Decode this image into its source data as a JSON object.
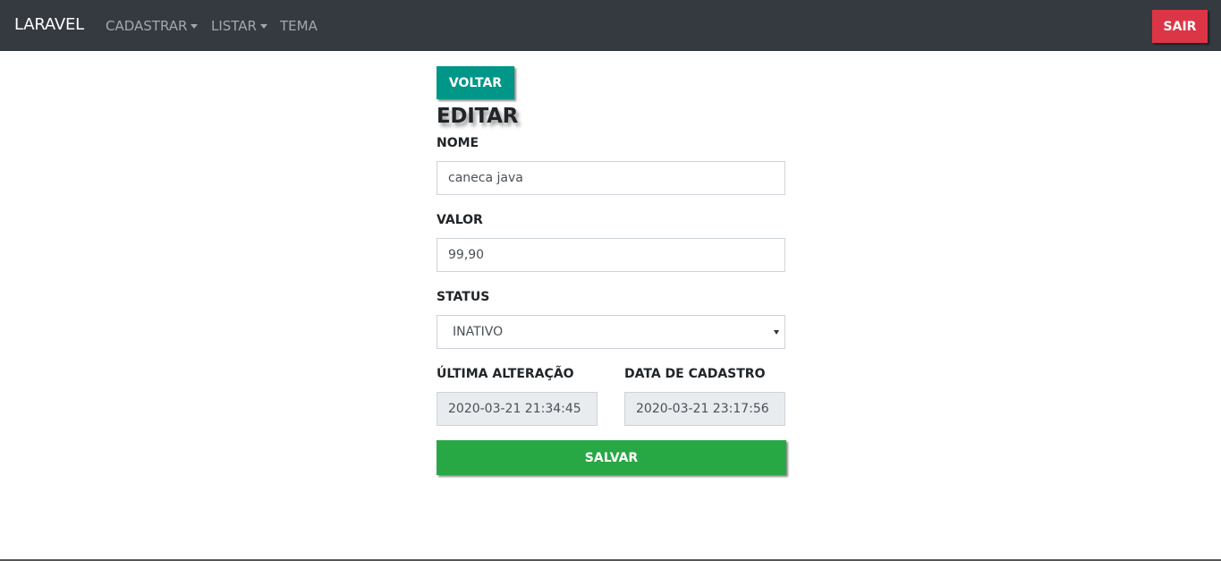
{
  "navbar": {
    "brand": "LARAVEL",
    "items": [
      {
        "label": "CADASTRAR",
        "dropdown": true
      },
      {
        "label": "LISTAR",
        "dropdown": true
      },
      {
        "label": "TEMA",
        "dropdown": false
      }
    ],
    "logout_label": "SAIR"
  },
  "page": {
    "back_label": "VOLTAR",
    "title": "EDITAR"
  },
  "form": {
    "nome": {
      "label": "NOME",
      "value": "caneca java"
    },
    "valor": {
      "label": "VALOR",
      "value": "99,90"
    },
    "status": {
      "label": "STATUS",
      "selected": "INATIVO"
    },
    "ultima_alteracao": {
      "label": "ÚLTIMA ALTERAÇÃO",
      "value": "2020-03-21 21:34:45"
    },
    "data_cadastro": {
      "label": "DATA DE CADASTRO",
      "value": "2020-03-21 23:17:56"
    },
    "submit_label": "SALVAR"
  },
  "colors": {
    "navbar_bg": "#343a40",
    "danger": "#dc3545",
    "teal": "#009688",
    "success": "#28a745",
    "readonly_bg": "#e9ecef"
  }
}
